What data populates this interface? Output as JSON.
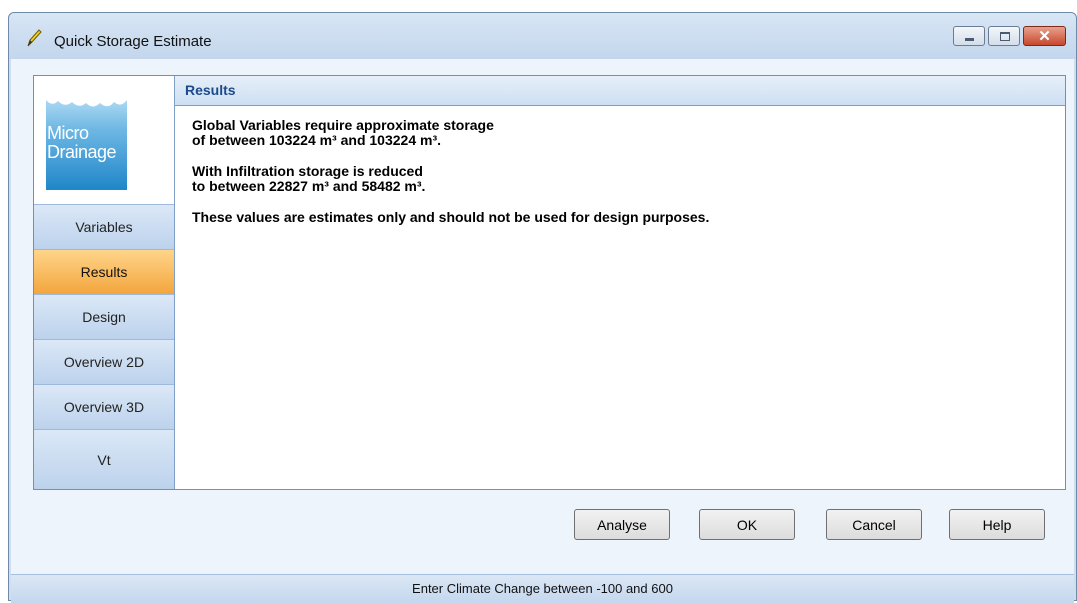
{
  "window": {
    "title": "Quick Storage Estimate"
  },
  "logo": {
    "line1": "Micro",
    "line2": "Drainage"
  },
  "nav": [
    {
      "label": "Variables",
      "active": false
    },
    {
      "label": "Results",
      "active": true
    },
    {
      "label": "Design",
      "active": false
    },
    {
      "label": "Overview 2D",
      "active": false
    },
    {
      "label": "Overview 3D",
      "active": false
    },
    {
      "label": "Vt",
      "active": false
    }
  ],
  "panel": {
    "header": "Results",
    "messages": [
      {
        "line1": "Global Variables require approximate storage",
        "line2": "of between 103224 m³ and 103224 m³."
      },
      {
        "line1": "With Infiltration storage is reduced",
        "line2": "to between 22827 m³ and 58482 m³."
      },
      {
        "line1": "These values are estimates only and should not be used for design purposes.",
        "line2": ""
      }
    ]
  },
  "buttons": {
    "analyse": "Analyse",
    "ok": "OK",
    "cancel": "Cancel",
    "help": "Help"
  },
  "status": {
    "text": "Enter Climate Change between -100 and 600"
  },
  "colors": {
    "active_tab": "#f3a53d",
    "header_text": "#1d4a8a",
    "nav_bg": "#cfe0f3"
  }
}
